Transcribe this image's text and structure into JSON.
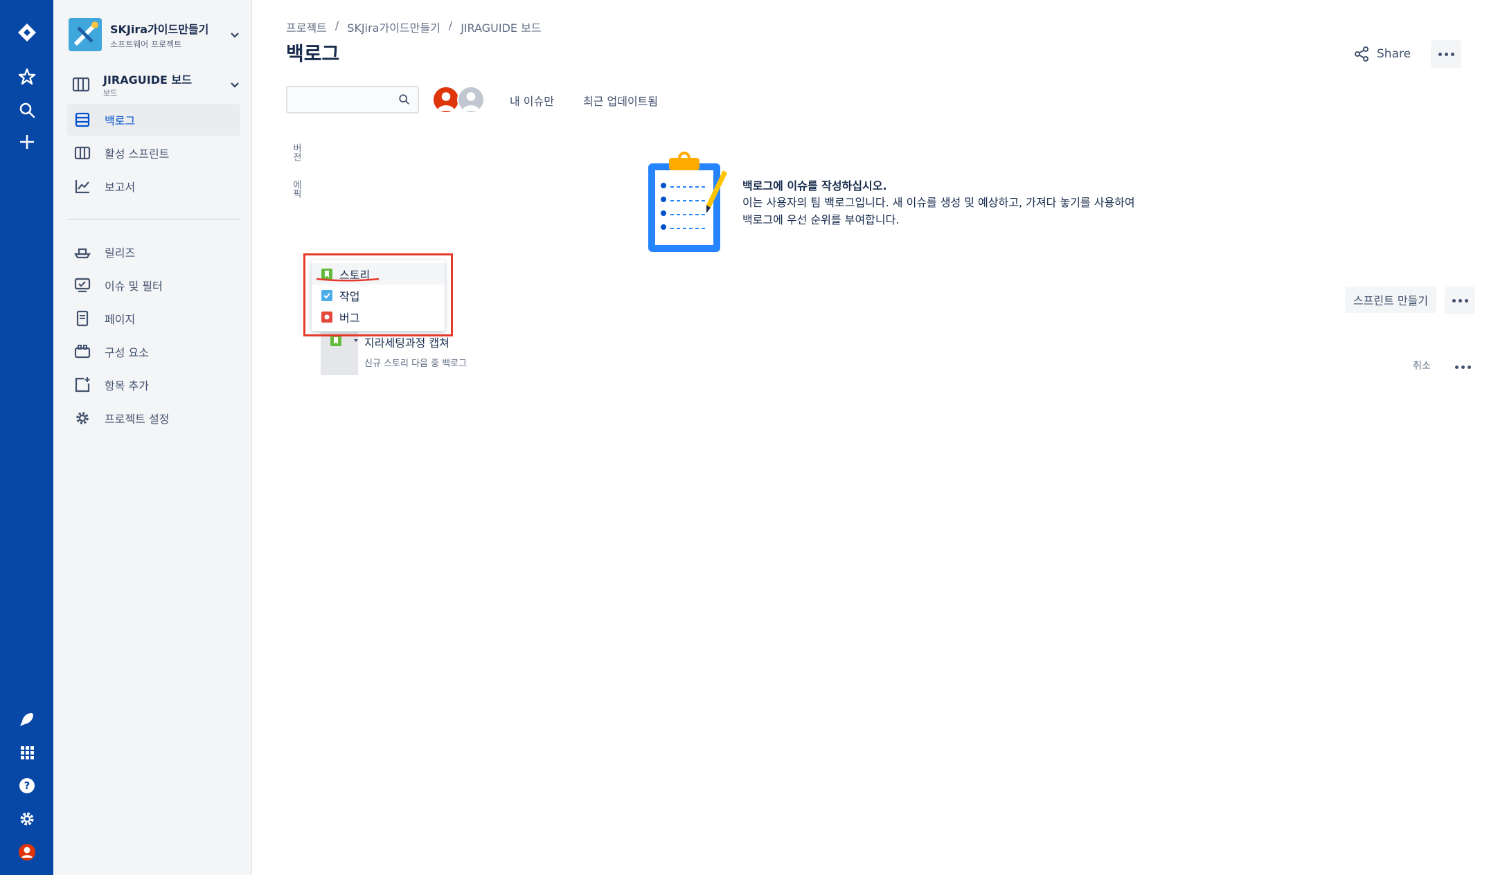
{
  "project": {
    "name": "SKJira가이드만들기",
    "type": "소프트웨어 프로젝트"
  },
  "board": {
    "name": "JIRAGUIDE 보드",
    "sub": "보드"
  },
  "sidebar": {
    "items": [
      {
        "label": "백로그",
        "icon": "backlog-icon",
        "active": true
      },
      {
        "label": "활성 스프린트",
        "icon": "board-columns-icon"
      },
      {
        "label": "보고서",
        "icon": "chart-icon"
      },
      {
        "label": "릴리즈",
        "icon": "ship-icon"
      },
      {
        "label": "이슈 및 필터",
        "icon": "issues-icon"
      },
      {
        "label": "페이지",
        "icon": "page-icon"
      },
      {
        "label": "구성 요소",
        "icon": "component-icon"
      },
      {
        "label": "항목 추가",
        "icon": "add-item-icon"
      },
      {
        "label": "프로젝트 설정",
        "icon": "gear-icon"
      }
    ]
  },
  "breadcrumbs": [
    "프로젝트",
    "SKJira가이드만들기",
    "JIRAGUIDE 보드"
  ],
  "breadcrumb_sep": "/",
  "page": {
    "title": "백로그"
  },
  "header": {
    "share_label": "Share"
  },
  "filters": {
    "mine": "내 이슈만",
    "recent": "최근 업데이트됨"
  },
  "vertical_tabs": [
    "버전",
    "에픽"
  ],
  "empty_state": {
    "title": "백로그에 이슈를 작성하십시오.",
    "description": "이는 사용자의 팀 백로그입니다. 새 이슈를 생성 및 예상하고, 가져다 놓기를 사용하여 백로그에 우선 순위를 부여합니다."
  },
  "sprint": {
    "create_label": "스프린트 만들기"
  },
  "issue_type_dropdown": {
    "options": [
      {
        "label": "스토리",
        "color": "#63ba3c"
      },
      {
        "label": "작업",
        "color": "#4bade8"
      },
      {
        "label": "버그",
        "color": "#e5493a"
      }
    ]
  },
  "create_issue": {
    "title": "지라세팅과정 캡쳐",
    "hint": "신규 스토리 다음 중 백로그",
    "cancel_label": "취소"
  },
  "colors": {
    "nav": "#0747a6",
    "annotation": "#e53a2b",
    "brand": "#0052cc"
  }
}
